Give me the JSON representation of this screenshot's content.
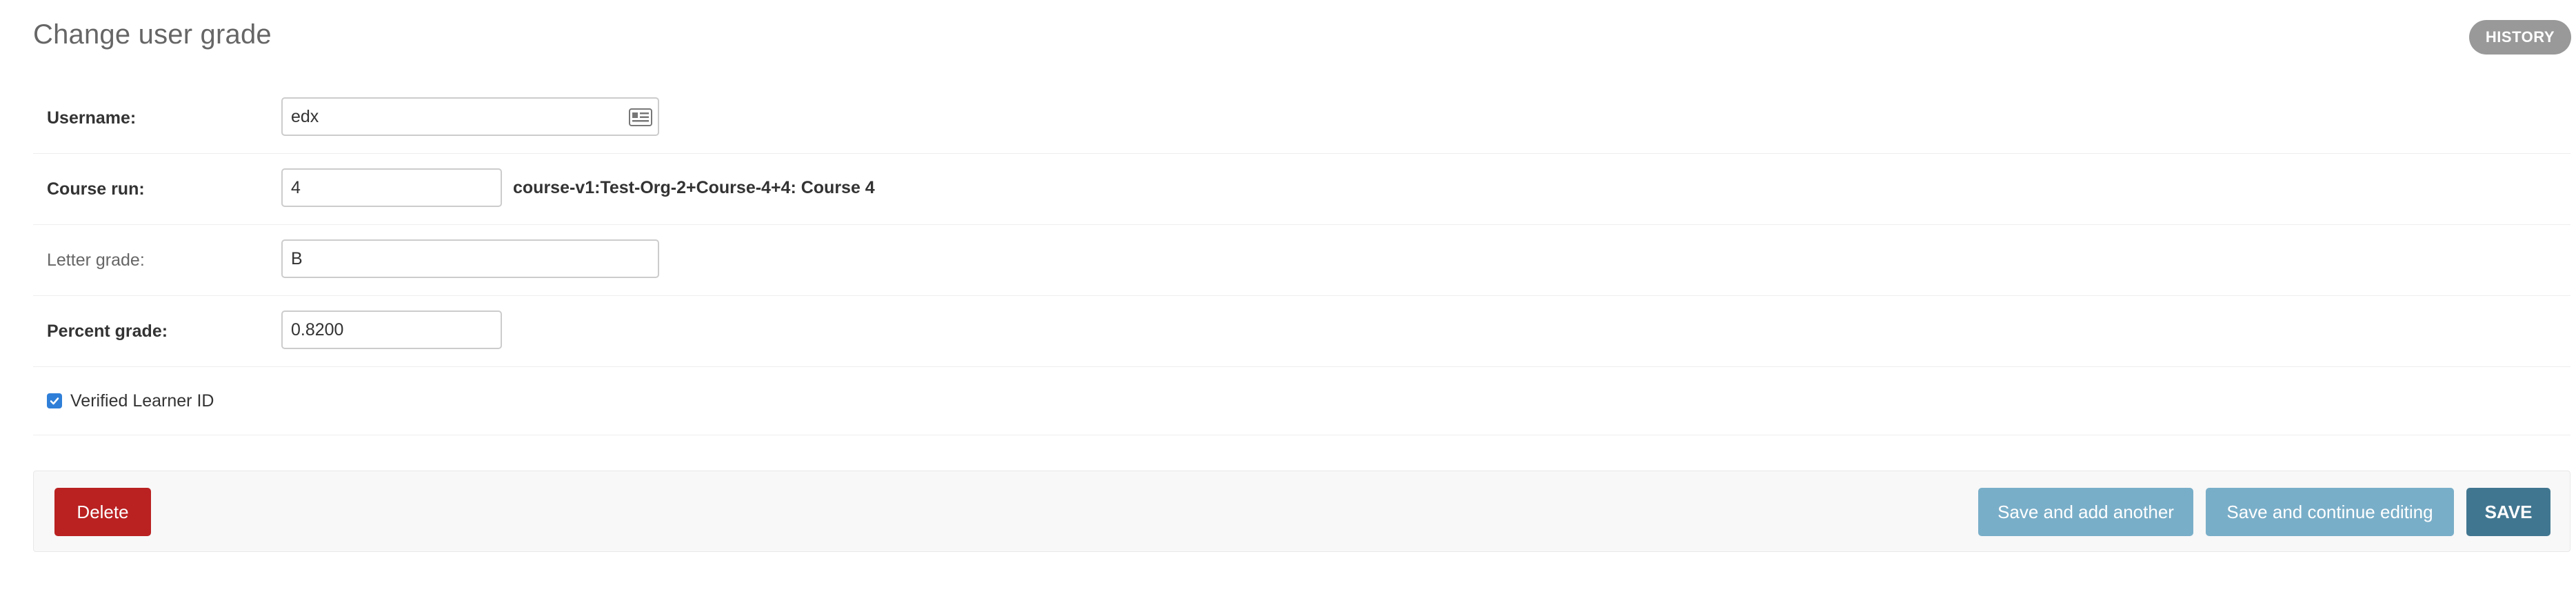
{
  "page": {
    "title": "Change user grade",
    "history_label": "HISTORY"
  },
  "fields": {
    "username": {
      "label": "Username:",
      "value": "edx"
    },
    "course_run": {
      "label": "Course run:",
      "value": "4",
      "helper": "course-v1:Test-Org-2+Course-4+4: Course 4"
    },
    "letter_grade": {
      "label": "Letter grade:",
      "value": "B"
    },
    "percent_grade": {
      "label": "Percent grade:",
      "value": "0.8200"
    },
    "verified": {
      "label": "Verified Learner ID",
      "checked": true
    }
  },
  "actions": {
    "delete_label": "Delete",
    "save_add_another_label": "Save and add another",
    "save_continue_label": "Save and continue editing",
    "save_label": "SAVE"
  },
  "colors": {
    "delete": "#ba2121",
    "secondary": "#79aec8",
    "primary": "#417690",
    "history": "#999999"
  },
  "icons": {
    "lookup": "lookup-icon",
    "check": "check-icon"
  }
}
